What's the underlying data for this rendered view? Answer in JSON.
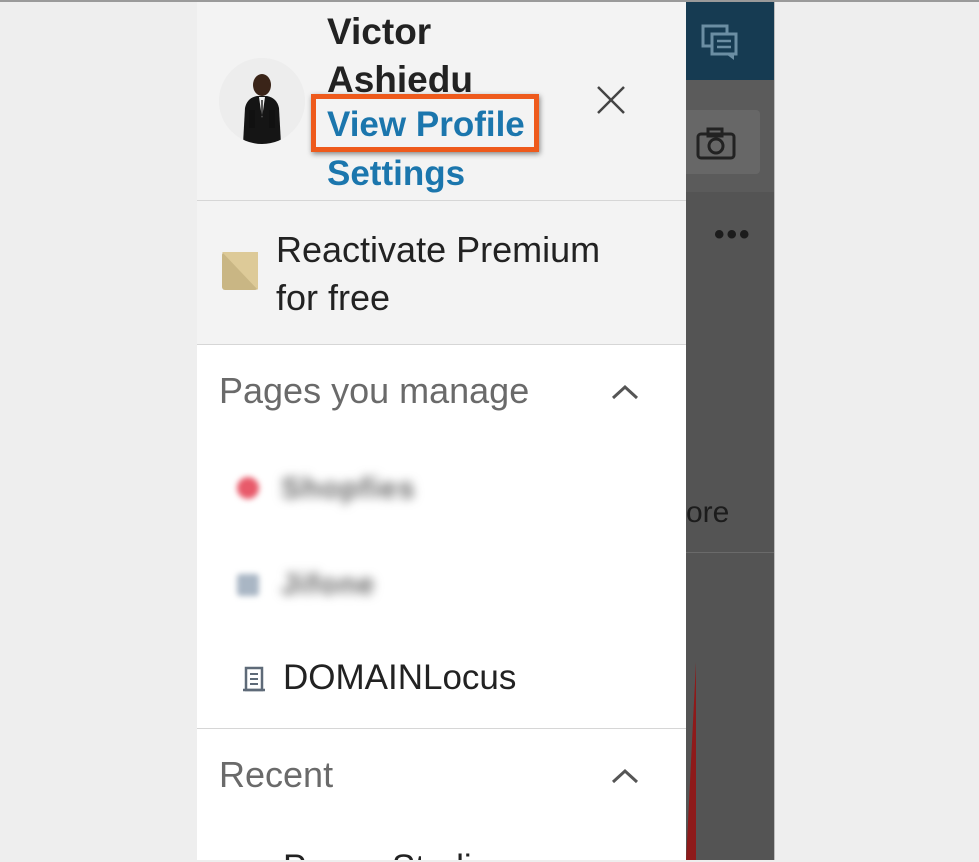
{
  "profile": {
    "name_line1": "Victor",
    "name_line2": "Ashiedu",
    "view_profile_label": "View Profile",
    "settings_label": "Settings"
  },
  "premium": {
    "label_line1": "Reactivate Premium",
    "label_line2": "for free"
  },
  "pages_section": {
    "title": "Pages you manage",
    "items": [
      {
        "label": "Shopfies",
        "blurred": true
      },
      {
        "label": "Jifone",
        "blurred": true
      },
      {
        "label": "DOMAINLocus",
        "blurred": false
      }
    ]
  },
  "recent_section": {
    "title": "Recent",
    "partial_item": "Power Studio"
  },
  "background": {
    "more_text": "ore",
    "dots": "•••"
  },
  "icons": [
    "avatar",
    "close-icon",
    "premium-icon",
    "chevron-up-icon",
    "building-icon",
    "messaging-icon",
    "camera-icon"
  ],
  "colors": {
    "link": "#1b76ad",
    "highlight_border": "#ee5a1c",
    "background_header": "#163b52"
  }
}
